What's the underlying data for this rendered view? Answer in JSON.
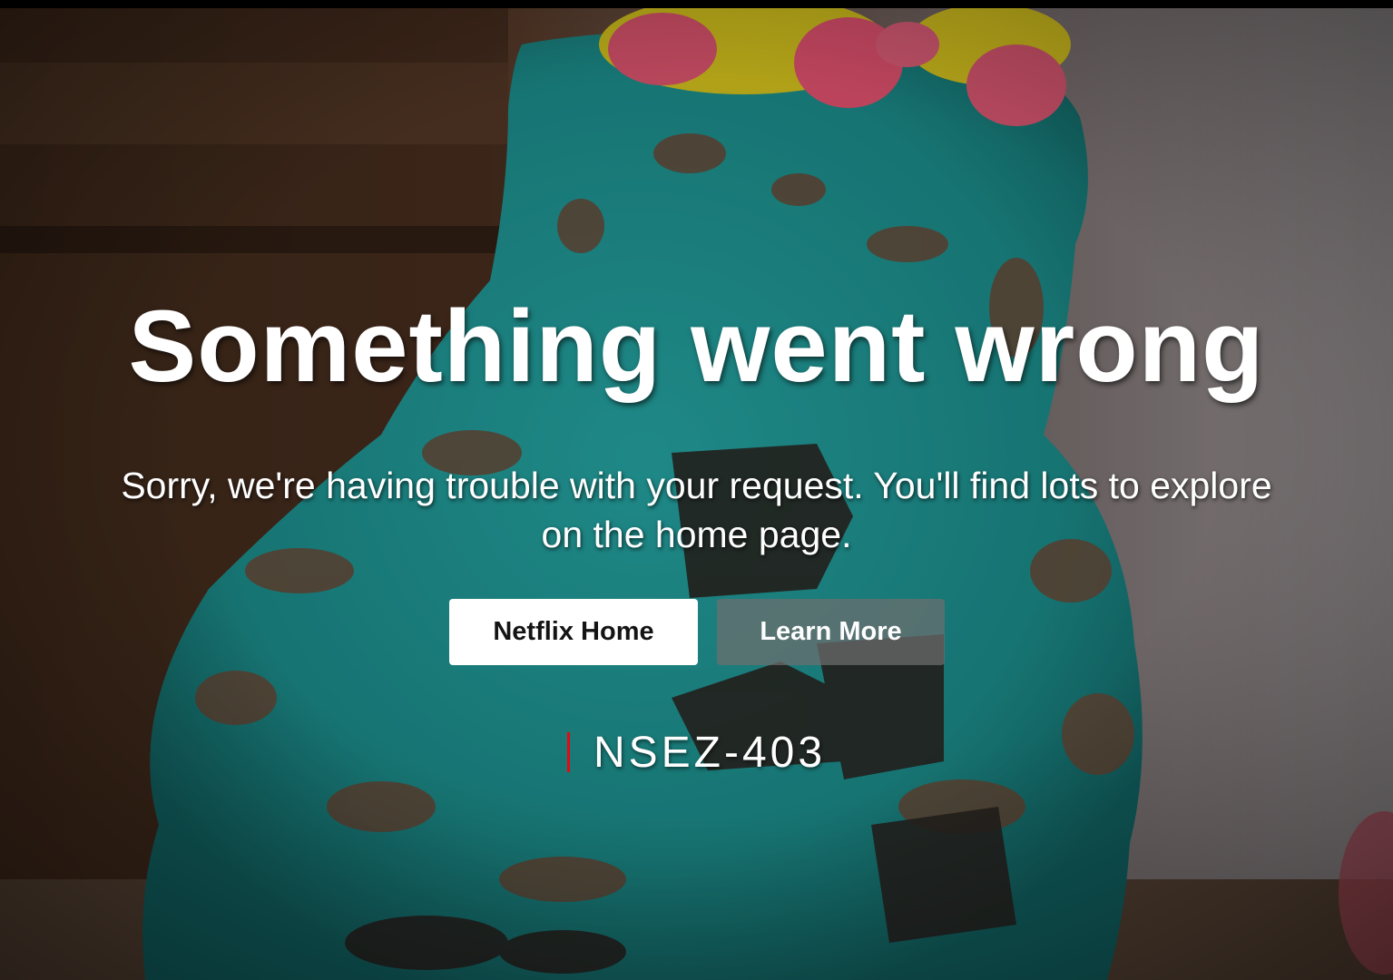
{
  "error_page": {
    "title": "Something went wrong",
    "message": "Sorry, we're having trouble with your request. You'll find lots to explore on the home page.",
    "buttons": {
      "home_label": "Netflix Home",
      "learn_label": "Learn More"
    },
    "error_code": "NSEZ-403"
  },
  "colors": {
    "accent_bar": "#e50914",
    "primary_button_bg": "#ffffff",
    "secondary_button_bg": "#6d6d6e"
  },
  "background": {
    "subject": "collapsed teal frosted cake with pink and yellow roses"
  }
}
